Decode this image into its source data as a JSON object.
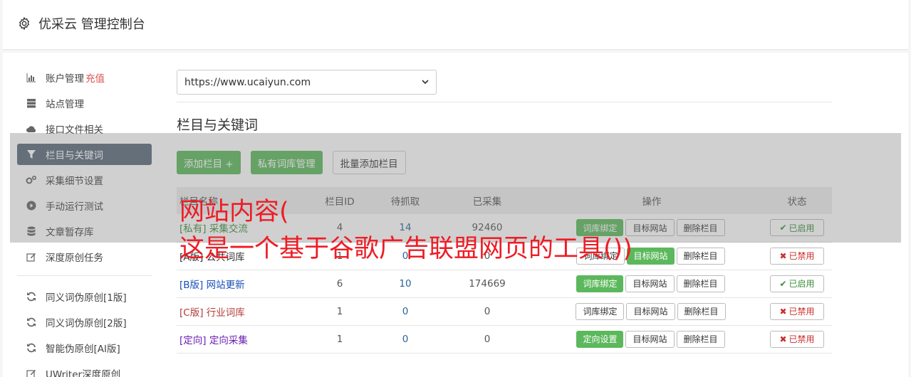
{
  "header": {
    "title": "优采云 管理控制台"
  },
  "sidebar": {
    "items": [
      {
        "icon": "bar-chart-icon",
        "label": "账户管理",
        "accent": "充值"
      },
      {
        "icon": "server-icon",
        "label": "站点管理"
      },
      {
        "icon": "cloud-upload-icon",
        "label": "接口文件相关"
      },
      {
        "icon": "filter-icon",
        "label": "栏目与关键词",
        "active": true
      },
      {
        "icon": "cogs-icon",
        "label": "采集细节设置"
      },
      {
        "icon": "play-circle-icon",
        "label": "手动运行测试"
      },
      {
        "icon": "database-icon",
        "label": "文章暂存库"
      },
      {
        "icon": "edit-icon",
        "label": "深度原创任务"
      }
    ],
    "items2": [
      {
        "icon": "refresh-icon",
        "label": "同义词伪原创[1版]"
      },
      {
        "icon": "refresh-icon",
        "label": "同义词伪原创[2版]"
      },
      {
        "icon": "refresh-icon",
        "label": "智能伪原创[AI版]"
      },
      {
        "icon": "edit-icon",
        "label": "UWriter深度原创"
      }
    ]
  },
  "main": {
    "site_select": "https://www.ucaiyun.com",
    "section_title": "栏目与关键词",
    "buttons": {
      "add": "添加栏目 +",
      "private_lib": "私有词库管理",
      "batch_add": "批量添加栏目"
    },
    "table": {
      "headers": [
        "栏目名称",
        "栏目ID",
        "待抓取",
        "已采集",
        "操作",
        "状态"
      ],
      "rows": [
        {
          "tag": "[私有]",
          "name": "采集交流",
          "id": "4",
          "pending": "14",
          "collected": "92460",
          "op1": "词库绑定",
          "op2": "目标网站",
          "op3": "删除栏目",
          "status": "已启用"
        },
        {
          "tag": "[A版]",
          "name": "公共词库",
          "id": "1",
          "pending": "0",
          "collected": "0",
          "op1": "词库绑定",
          "op2": "目标网站",
          "op3": "删除栏目",
          "status": "已禁用"
        },
        {
          "tag": "[B版]",
          "name": "网站更新",
          "id": "6",
          "pending": "10",
          "collected": "174669",
          "op1": "词库绑定",
          "op2": "目标网站",
          "op3": "删除栏目",
          "status": "已启用"
        },
        {
          "tag": "[C版]",
          "name": "行业词库",
          "id": "1",
          "pending": "0",
          "collected": "0",
          "op1": "词库绑定",
          "op2": "目标网站",
          "op3": "删除栏目",
          "status": "已禁用"
        },
        {
          "tag": "[定向]",
          "name": "定向采集",
          "id": "1",
          "pending": "0",
          "collected": "0",
          "op1": "定向设置",
          "op2": "目标网站",
          "op3": "删除栏目",
          "status": "已禁用"
        }
      ]
    }
  },
  "overlay": {
    "line1": "网站内容(",
    "line2": "这是一个基于谷歌广告联盟网页的工具())"
  },
  "colors": {
    "green": "#5cb85c",
    "active_sidebar": "#5b6a7c",
    "overlay_text": "#ee1c25",
    "link_blue": "#2a6496"
  }
}
